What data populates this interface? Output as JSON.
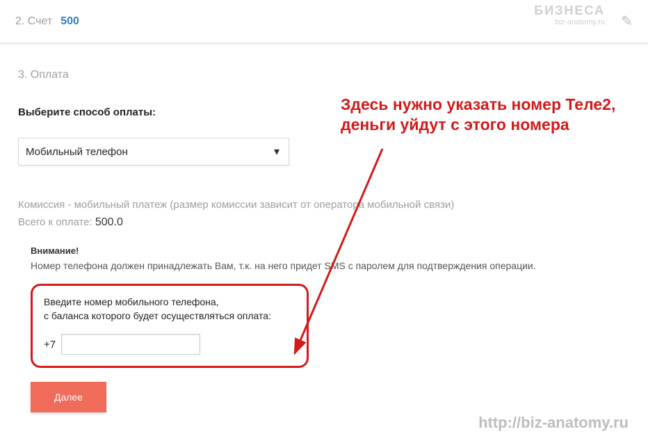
{
  "step2": {
    "label": "2. Счет",
    "amount": "500"
  },
  "step3": {
    "label": "3. Оплата",
    "choose_label": "Выберите способ оплаты:",
    "method_selected": "Мобильный телефон",
    "fee_line": "Комиссия - мобильный платеж (размер комиссии зависит от оператора мобильной связи)",
    "total_label": "Всего к оплате:",
    "total_value": "500.0",
    "warn_title": "Внимание!",
    "warn_text": "Номер телефона должен принадлежать Вам, т.к. на него придет SMS с паролем для подтверждения операции.",
    "phone_label": "Введите номер мобильного телефона,\nс баланса которого будет осуществляться оплата:",
    "phone_prefix": "+7",
    "phone_value": "",
    "next_label": "Далее"
  },
  "annotation_text": "Здесь нужно указать номер Теле2, деньги уйдут с этого номера",
  "footer_url": "http://biz-anatomy.ru",
  "watermark": {
    "line1": "БИЗНЕСА",
    "line2": "biz-anatomy.ru"
  }
}
